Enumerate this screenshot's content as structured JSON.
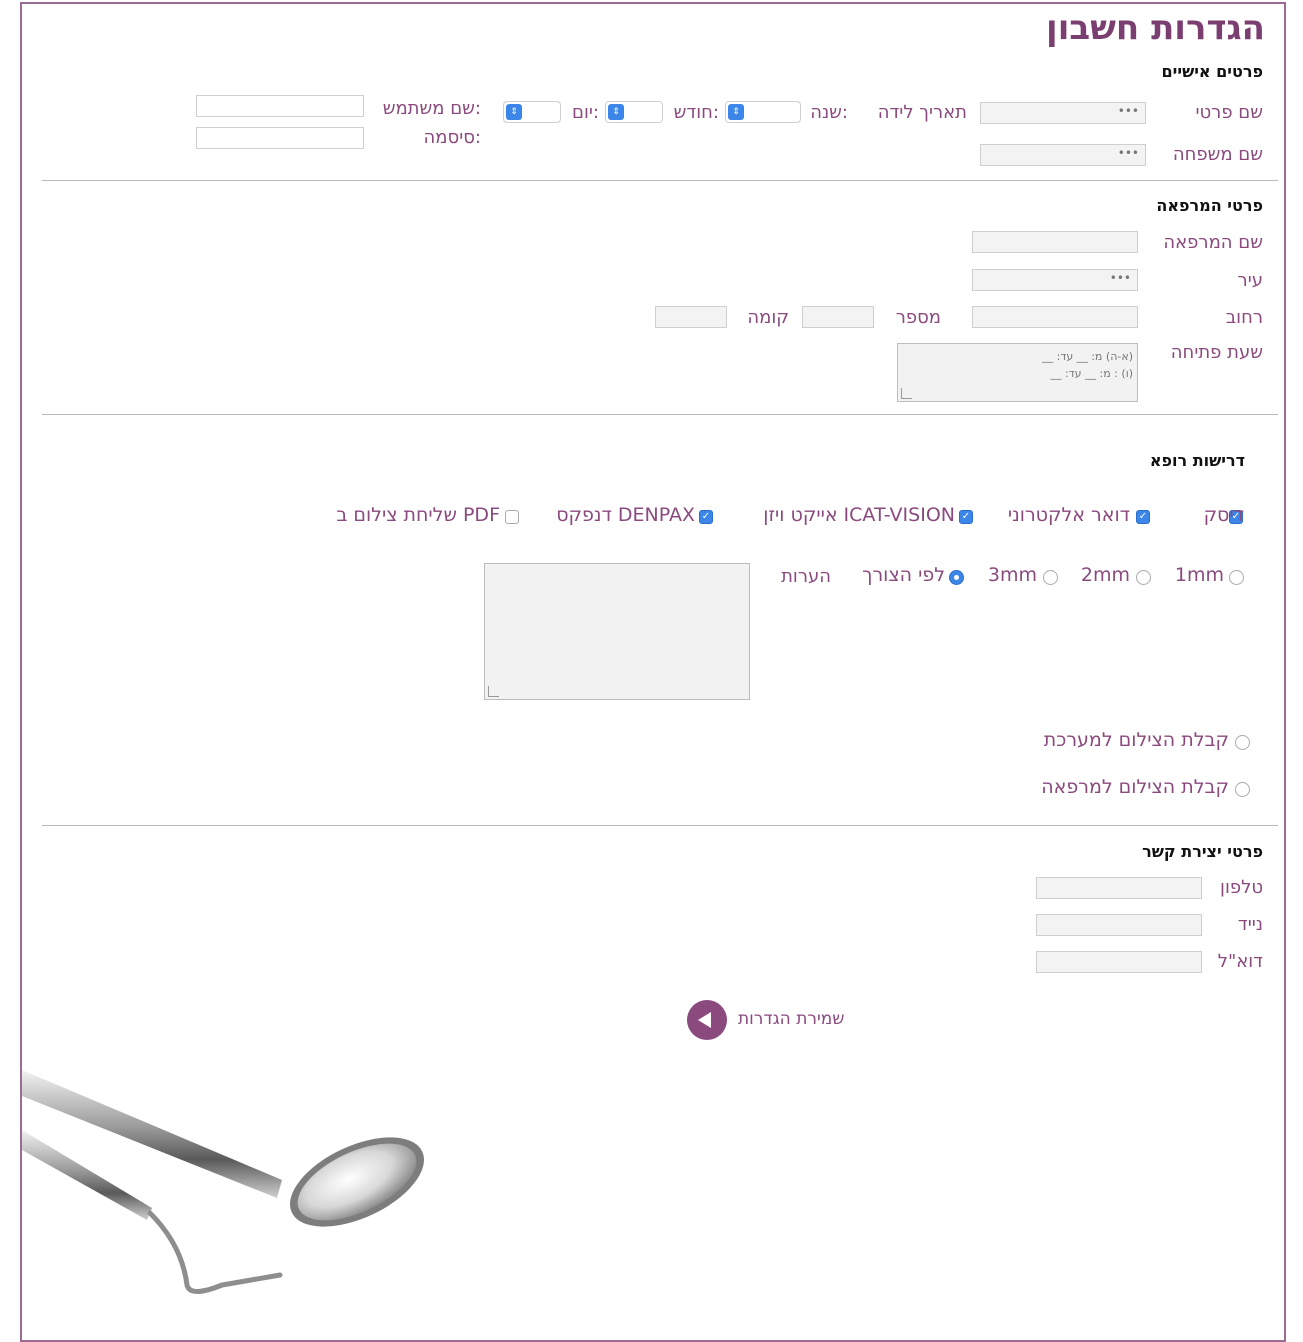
{
  "page_title": "הגדרות חשבון",
  "personal": {
    "heading": "פרטים אישיים",
    "first_name_label": "שם פרטי",
    "last_name_label": "שם משפחה",
    "birthdate_label": "תאריך לידה",
    "year_label": "שנה:",
    "month_label": "חודש:",
    "day_label": "יום:",
    "username_label": "שם משתמש:",
    "password_label": "סיסמה:"
  },
  "clinic": {
    "heading": "פרטי המרפאה",
    "name_label": "שם המרפאה",
    "city_label": "עיר",
    "street_label": "רחוב",
    "number_label": "מספר",
    "floor_label": "קומה",
    "hours_label": "שעת פתיחה",
    "hours_placeholder_line1": "(א-ה) מ: __ עד: __",
    "hours_placeholder_line2": "(ו) : מ: __ עד: __"
  },
  "doctor": {
    "heading": "דרישות רופא",
    "delivery": [
      {
        "label": "דיסק",
        "checked": true
      },
      {
        "label": "דואר אלקטרוני",
        "checked": true
      },
      {
        "label": "אייקט ויזן ICAT-VISION",
        "checked": true
      },
      {
        "label": "דנפקס DENPAX",
        "checked": true
      },
      {
        "label": "שליחת צילום ב PDF",
        "checked": false
      }
    ],
    "slices": [
      {
        "label": "1mm",
        "selected": false
      },
      {
        "label": "2mm",
        "selected": false
      },
      {
        "label": "3mm",
        "selected": false
      },
      {
        "label": "לפי הצורך",
        "selected": true
      }
    ],
    "notes_label": "הערות",
    "receive_options": [
      {
        "label": "קבלת הצילום למערכת",
        "selected": false
      },
      {
        "label": "קבלת הצילום למרפאה",
        "selected": false
      }
    ]
  },
  "contact": {
    "heading": "פרטי יצירת קשר",
    "phone_label": "טלפון",
    "mobile_label": "נייד",
    "email_label": "דוא\"ל"
  },
  "save_label": "שמירת הגדרות",
  "colors": {
    "accent": "#8a4a7e",
    "checkbox": "#3b86e8"
  }
}
